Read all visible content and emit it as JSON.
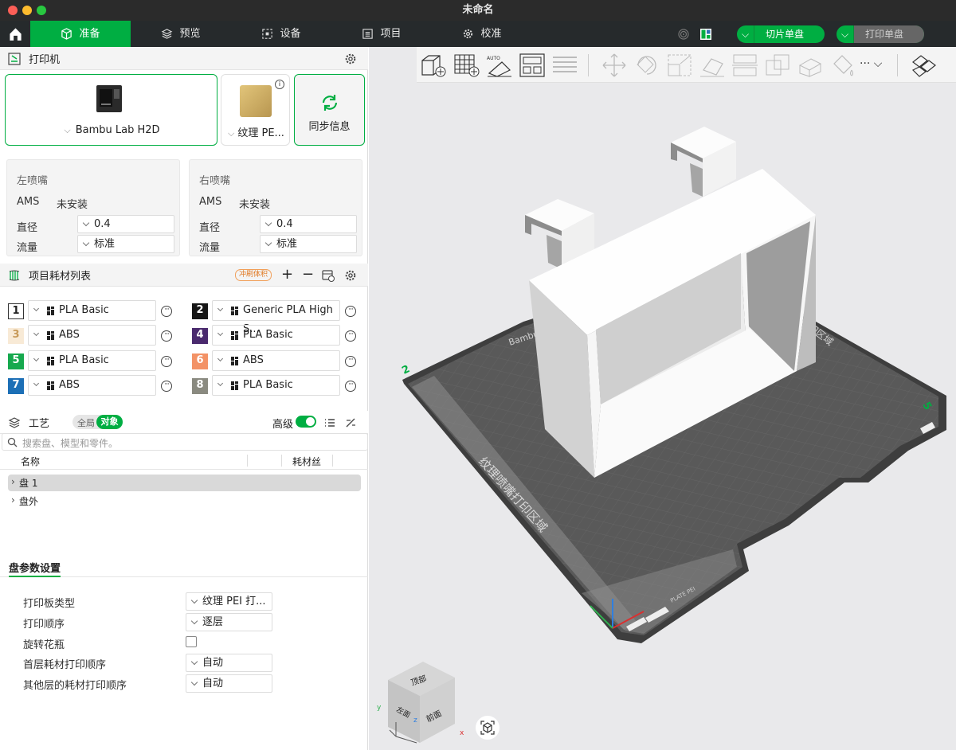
{
  "window": {
    "title": "未命名"
  },
  "nav": {
    "tabs": [
      {
        "label": "准备"
      },
      {
        "label": "预览"
      },
      {
        "label": "设备"
      },
      {
        "label": "项目"
      },
      {
        "label": "校准"
      }
    ],
    "slice_btn": "切片单盘",
    "print_btn": "打印单盘"
  },
  "printer": {
    "section": "打印机",
    "name": "Bambu Lab H2D",
    "plate": "纹理 PE...",
    "sync": "同步信息",
    "left": {
      "title": "左喷嘴",
      "ams_label": "AMS",
      "ams_value": "未安装",
      "dia_label": "直径",
      "dia": "0.4",
      "flow_label": "流量",
      "flow": "标准"
    },
    "right": {
      "title": "右喷嘴",
      "ams_label": "AMS",
      "ams_value": "未安装",
      "dia_label": "直径",
      "dia": "0.4",
      "flow_label": "流量",
      "flow": "标准"
    }
  },
  "filament": {
    "section": "项目耗材列表",
    "flush": "冲刷体积",
    "items": [
      {
        "n": "1",
        "name": "PLA Basic",
        "color": "#ffffff",
        "fg": "#222"
      },
      {
        "n": "2",
        "name": "Generic PLA High S...",
        "color": "#161616",
        "fg": "#fff"
      },
      {
        "n": "3",
        "name": "ABS",
        "color": "#f8ead6",
        "fg": "#c79a5a"
      },
      {
        "n": "4",
        "name": "PLA Basic",
        "color": "#4a2a6e",
        "fg": "#fff"
      },
      {
        "n": "5",
        "name": "PLA Basic",
        "color": "#16a94e",
        "fg": "#fff"
      },
      {
        "n": "6",
        "name": "ABS",
        "color": "#f39266",
        "fg": "#fff"
      },
      {
        "n": "7",
        "name": "ABS",
        "color": "#1c6fb6",
        "fg": "#fff"
      },
      {
        "n": "8",
        "name": "PLA Basic",
        "color": "#8a8a80",
        "fg": "#fff"
      }
    ]
  },
  "process": {
    "section": "工艺",
    "global": "全局",
    "object": "对象",
    "advanced": "高级",
    "search_placeholder": "搜索盘、模型和零件。",
    "col_name": "名称",
    "col_fil": "耗材丝",
    "tree": [
      "盘 1",
      "盘外"
    ]
  },
  "plate_settings": {
    "tab": "盘参数设置",
    "rows": [
      {
        "label": "打印板类型",
        "value": "纹理 PEI 打..."
      },
      {
        "label": "打印顺序",
        "value": "逐层"
      },
      {
        "label": "旋转花瓶",
        "value": ""
      },
      {
        "label": "首层耗材打印顺序",
        "value": "自动"
      },
      {
        "label": "其他层的耗材打印顺序",
        "value": "自动"
      }
    ]
  },
  "viewport": {
    "bed_text_1": "纹理喷嘴打印区域",
    "bed_text_2": "打印区域",
    "bed_brand": "Bambu",
    "bed_label": "PLATE PEI",
    "cube_top": "顶部",
    "cube_left": "左面",
    "cube_front": "前面",
    "axis_x": "x",
    "axis_y": "y",
    "axis_z": "z"
  }
}
